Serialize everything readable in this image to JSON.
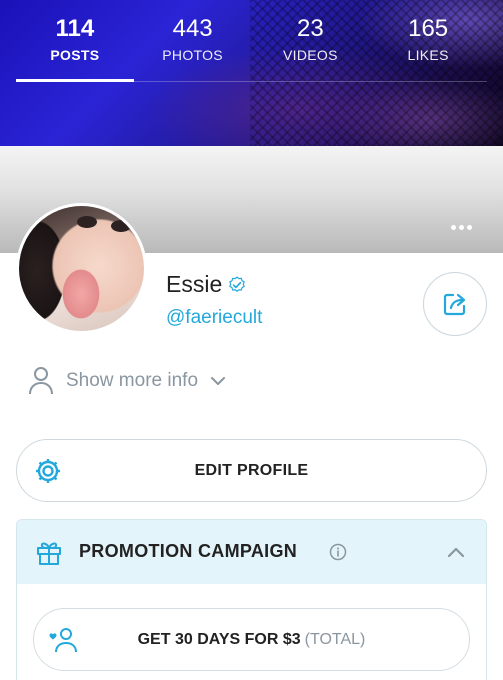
{
  "stats": [
    {
      "value": "114",
      "label": "POSTS",
      "active": true
    },
    {
      "value": "443",
      "label": "PHOTOS",
      "active": false
    },
    {
      "value": "23",
      "label": "VIDEOS",
      "active": false
    },
    {
      "value": "165",
      "label": "LIKES",
      "active": false
    }
  ],
  "profile": {
    "name": "Essie",
    "handle": "@faeriecult",
    "verified_icon": "verified-check-icon",
    "share_icon": "share-icon"
  },
  "more_info": {
    "label": "Show more info",
    "icon": "user-icon"
  },
  "edit_profile": {
    "label": "EDIT PROFILE",
    "icon": "gear-icon"
  },
  "promotion": {
    "title": "PROMOTION CAMPAIGN",
    "offer_label": "GET 30 DAYS FOR $3",
    "offer_suffix": "(TOTAL)"
  },
  "colors": {
    "accent": "#23a8dc",
    "promo_header_bg": "#e4f4fb",
    "text": "#222222",
    "muted": "#8a96a0"
  }
}
